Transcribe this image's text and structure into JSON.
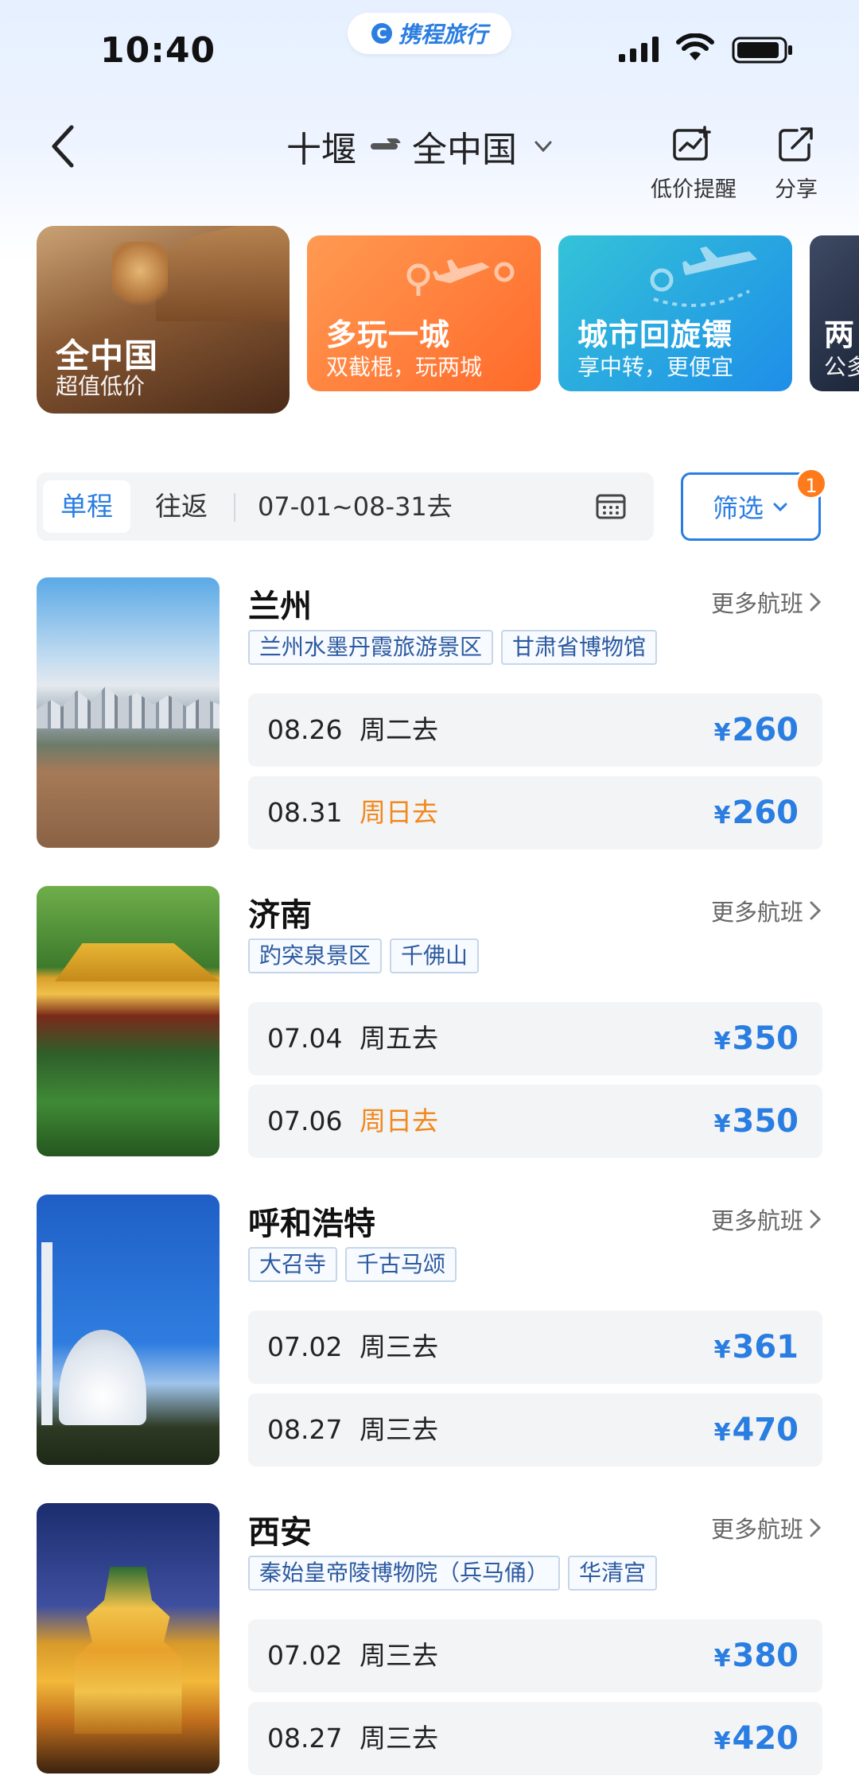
{
  "status": {
    "time": "10:40"
  },
  "brand": {
    "mark": "C",
    "name": "携程旅行"
  },
  "header": {
    "origin": "十堰",
    "destination": "全中国",
    "low_price_alert": "低价提醒",
    "share": "分享"
  },
  "banners": [
    {
      "title": "全中国",
      "subtitle": "超值低价"
    },
    {
      "title": "多玩一城",
      "subtitle": "双截棍，玩两城"
    },
    {
      "title": "城市回旋镖",
      "subtitle": "享中转，更便宜"
    },
    {
      "title": "两",
      "subtitle": "公多"
    }
  ],
  "trip": {
    "tab_oneway": "单程",
    "tab_round": "往返",
    "date_range": "07-01~08-31去",
    "filter": "筛选",
    "filter_count": "1"
  },
  "more_label": "更多航班",
  "cards": [
    {
      "city": "兰州",
      "tags": [
        "兰州水墨丹霞旅游景区",
        "甘肃省博物馆"
      ],
      "flights": [
        {
          "date": "08.26",
          "weekday": "周二去",
          "weekend": false,
          "price": "260"
        },
        {
          "date": "08.31",
          "weekday": "周日去",
          "weekend": true,
          "price": "260"
        }
      ]
    },
    {
      "city": "济南",
      "tags": [
        "趵突泉景区",
        "千佛山"
      ],
      "flights": [
        {
          "date": "07.04",
          "weekday": "周五去",
          "weekend": false,
          "price": "350"
        },
        {
          "date": "07.06",
          "weekday": "周日去",
          "weekend": true,
          "price": "350"
        }
      ]
    },
    {
      "city": "呼和浩特",
      "tags": [
        "大召寺",
        "千古马颂"
      ],
      "flights": [
        {
          "date": "07.02",
          "weekday": "周三去",
          "weekend": false,
          "price": "361"
        },
        {
          "date": "08.27",
          "weekday": "周三去",
          "weekend": false,
          "price": "470"
        }
      ]
    },
    {
      "city": "西安",
      "tags": [
        "秦始皇帝陵博物院（兵马俑）",
        "华清宫"
      ],
      "flights": [
        {
          "date": "07.02",
          "weekday": "周三去",
          "weekend": false,
          "price": "380"
        },
        {
          "date": "08.27",
          "weekday": "周三去",
          "weekend": false,
          "price": "420"
        }
      ]
    }
  ],
  "currency": "¥",
  "colors": {
    "accent": "#2a7de1",
    "weekend": "#f0891e",
    "badge": "#ff7a1a"
  }
}
